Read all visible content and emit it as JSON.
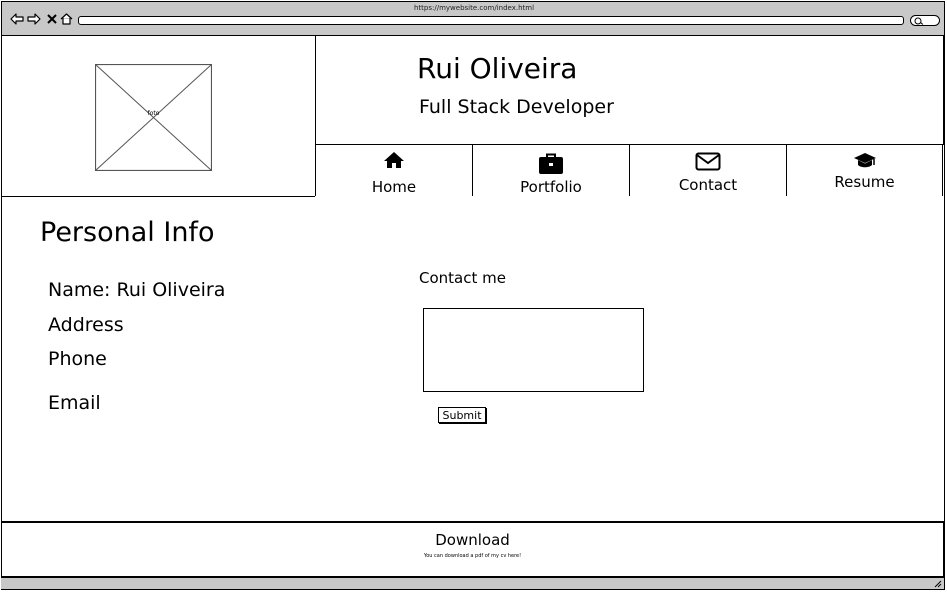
{
  "browser": {
    "url": "https://mywebsite.com/index.html",
    "icons": [
      "back-arrow-icon",
      "forward-arrow-icon",
      "close-icon",
      "home-icon",
      "search-icon"
    ]
  },
  "photo": {
    "label": "foto"
  },
  "header": {
    "name": "Rui Oliveira",
    "job_title": "Full Stack Developer"
  },
  "nav": {
    "items": [
      {
        "label": "Home",
        "icon": "house-icon"
      },
      {
        "label": "Portfolio",
        "icon": "briefcase-icon"
      },
      {
        "label": "Contact",
        "icon": "envelope-icon"
      },
      {
        "label": "Resume",
        "icon": "graduation-cap-icon"
      }
    ]
  },
  "personal_info": {
    "title": "Personal Info",
    "name_line": "Name: Rui Oliveira",
    "address_line": "Address",
    "phone_line": "Phone",
    "email_line": "Email"
  },
  "contact": {
    "label": "Contact me",
    "textarea_value": "",
    "submit_label": "Submit"
  },
  "footer": {
    "download_label": "Download",
    "download_sub": "You can download a pdf of my cv here!"
  }
}
